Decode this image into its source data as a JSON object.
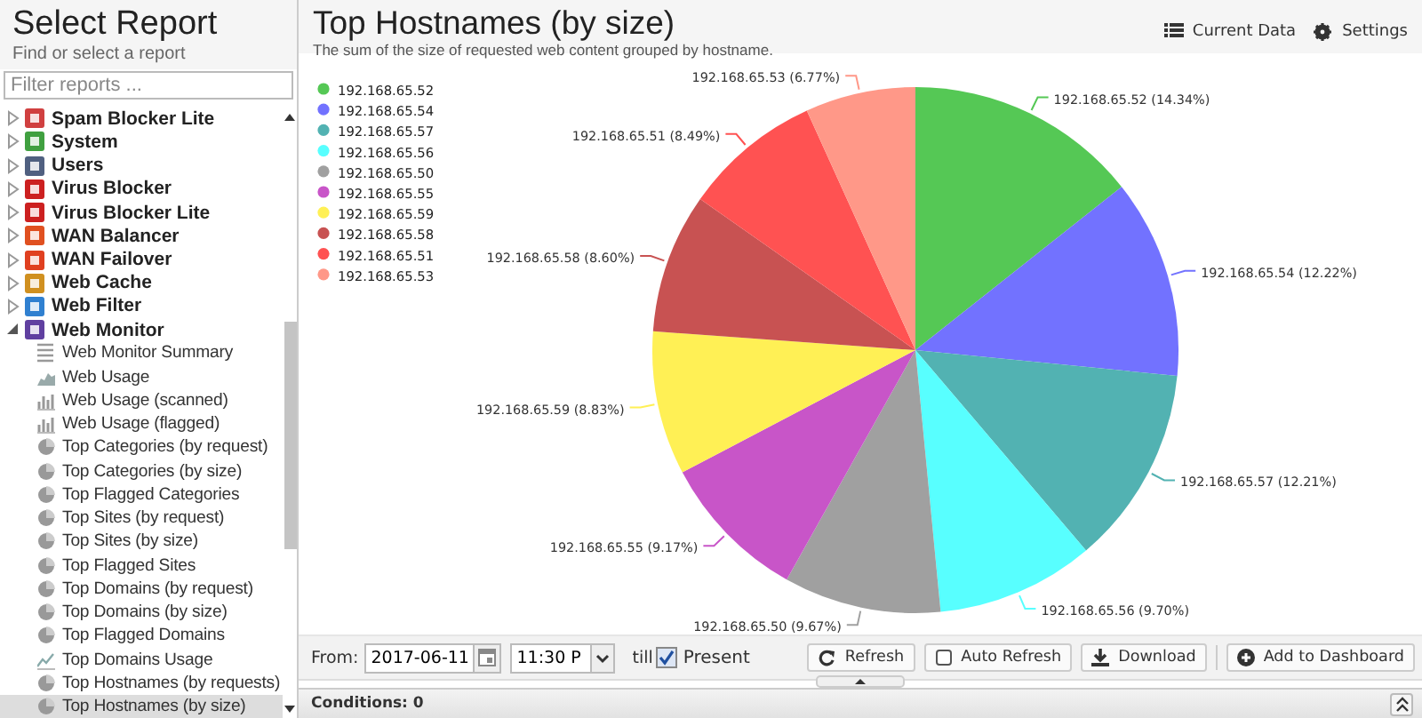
{
  "sidebar": {
    "title": "Select Report",
    "subtitle": "Find or select a report",
    "filter": {
      "placeholder": "Filter reports ..."
    },
    "tree": [
      {
        "label": "Spam Blocker Lite",
        "color": "#d04040",
        "expanded": false
      },
      {
        "label": "System",
        "color": "#40a040",
        "expanded": false
      },
      {
        "label": "Users",
        "color": "#506080",
        "expanded": false
      },
      {
        "label": "Virus Blocker",
        "color": "#cc2020",
        "expanded": false
      },
      {
        "label": "Virus Blocker Lite",
        "color": "#cc2020",
        "expanded": false
      },
      {
        "label": "WAN Balancer",
        "color": "#e05020",
        "expanded": false
      },
      {
        "label": "WAN Failover",
        "color": "#e04020",
        "expanded": false
      },
      {
        "label": "Web Cache",
        "color": "#d09020",
        "expanded": false
      },
      {
        "label": "Web Filter",
        "color": "#3080d0",
        "expanded": false
      },
      {
        "label": "Web Monitor",
        "color": "#6040a0",
        "expanded": true,
        "children": [
          {
            "label": "Web Monitor Summary",
            "kind": "text",
            "selected": false
          },
          {
            "label": "Web Usage",
            "kind": "area",
            "selected": false
          },
          {
            "label": "Web Usage (scanned)",
            "kind": "bar",
            "selected": false
          },
          {
            "label": "Web Usage (flagged)",
            "kind": "bar",
            "selected": false
          },
          {
            "label": "Top Categories (by request)",
            "kind": "pie",
            "selected": false
          },
          {
            "label": "Top Categories (by size)",
            "kind": "pie",
            "selected": false
          },
          {
            "label": "Top Flagged Categories",
            "kind": "pie",
            "selected": false
          },
          {
            "label": "Top Sites (by request)",
            "kind": "pie",
            "selected": false
          },
          {
            "label": "Top Sites (by size)",
            "kind": "pie",
            "selected": false
          },
          {
            "label": "Top Flagged Sites",
            "kind": "pie",
            "selected": false
          },
          {
            "label": "Top Domains (by request)",
            "kind": "pie",
            "selected": false
          },
          {
            "label": "Top Domains (by size)",
            "kind": "pie",
            "selected": false
          },
          {
            "label": "Top Flagged Domains",
            "kind": "pie",
            "selected": false
          },
          {
            "label": "Top Domains Usage",
            "kind": "line",
            "selected": false
          },
          {
            "label": "Top Hostnames (by requests)",
            "kind": "pie",
            "selected": false
          },
          {
            "label": "Top Hostnames (by size)",
            "kind": "pie",
            "selected": true
          }
        ]
      }
    ]
  },
  "report": {
    "title": "Top Hostnames (by size)",
    "description": "The sum of the size of requested web content grouped by hostname.",
    "header_buttons": [
      {
        "label": "Current Data",
        "kind": "data"
      },
      {
        "label": "Settings",
        "kind": "settings"
      }
    ],
    "chart_data": {
      "type": "pie",
      "categories": [
        "192.168.65.52",
        "192.168.65.54",
        "192.168.65.57",
        "192.168.65.56",
        "192.168.65.50",
        "192.168.65.55",
        "192.168.65.59",
        "192.168.65.58",
        "192.168.65.51",
        "192.168.65.53"
      ],
      "legend": "top-left",
      "series": [
        {
          "values": [
            14.34,
            12.22,
            12.21,
            9.7,
            9.67,
            9.17,
            8.83,
            8.6,
            8.49,
            6.77
          ],
          "colors": [
            "#55c855",
            "#7272ff",
            "#52b2b2",
            "#58ffff",
            "#a0a0a0",
            "#c855c8",
            "#fff055",
            "#c85252",
            "#ff5252",
            "#ff9888"
          ]
        }
      ],
      "value_labels": [
        "192.168.65.52 (14.34%)",
        "192.168.65.54 (12.22%)",
        "192.168.65.57 (12.21%)",
        "192.168.65.56 (9.70%)",
        "192.168.65.50 (9.67%)",
        "192.168.65.55 (9.17%)",
        "192.168.65.59 (8.83%)",
        "192.168.65.58 (8.60%)",
        "192.168.65.51 (8.49%)",
        "192.168.65.53 (6.77%)"
      ]
    }
  },
  "toolbar": {
    "from_label": "From:",
    "date": "2017-06-11",
    "time": "11:30 P",
    "till_label": "till",
    "present": {
      "label": "Present",
      "checked": true
    },
    "buttons": [
      {
        "label": "Refresh",
        "kind": "refresh"
      },
      {
        "label": "Auto Refresh",
        "kind": "check"
      },
      {
        "label": "Download",
        "kind": "download"
      },
      {
        "label": "Add to Dashboard",
        "kind": "add"
      }
    ]
  },
  "conditions": {
    "label": "Conditions: 0"
  }
}
